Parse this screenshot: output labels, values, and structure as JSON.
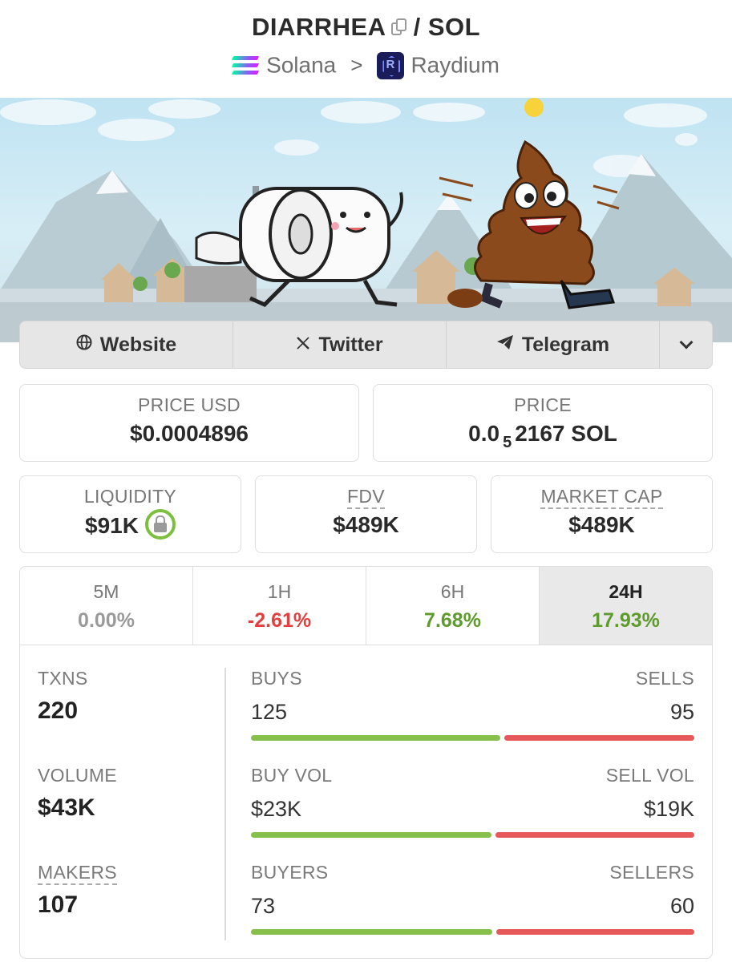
{
  "header": {
    "token": "DIARRHEA",
    "separator": "/",
    "quote": "SOL",
    "chain": "Solana",
    "dex": "Raydium"
  },
  "icons": {
    "copy": "copy-icon",
    "chain": "solana-logo-icon",
    "dex": "raydium-logo-icon",
    "website": "globe-icon",
    "twitter": "x-logo-icon",
    "telegram": "telegram-plane-icon",
    "more": "chevron-down-icon",
    "lock": "lock-icon"
  },
  "socials": {
    "website": "Website",
    "twitter": "Twitter",
    "telegram": "Telegram"
  },
  "price": {
    "usd_label": "PRICE USD",
    "usd_value": "$0.0004896",
    "native_label": "PRICE",
    "native_prefix": "0.0",
    "native_zeros": "5",
    "native_rest": "2167 SOL"
  },
  "metrics": {
    "liquidity_label": "LIQUIDITY",
    "liquidity_value": "$91K",
    "fdv_label": "FDV",
    "fdv_value": "$489K",
    "mcap_label": "MARKET CAP",
    "mcap_value": "$489K"
  },
  "timeframes": [
    {
      "label": "5M",
      "change": "0.00%"
    },
    {
      "label": "1H",
      "change": "-2.61%"
    },
    {
      "label": "6H",
      "change": "7.68%"
    },
    {
      "label": "24H",
      "change": "17.93%"
    }
  ],
  "selected_timeframe": "24H",
  "stats": {
    "txns_label": "TXNS",
    "txns_value": "220",
    "volume_label": "VOLUME",
    "volume_value": "$43K",
    "makers_label": "MAKERS",
    "makers_value": "107",
    "buys_label": "BUYS",
    "buys_value": "125",
    "sells_label": "SELLS",
    "sells_value": "95",
    "buy_vol_label": "BUY VOL",
    "buy_vol_value": "$23K",
    "sell_vol_label": "SELL VOL",
    "sell_vol_value": "$19K",
    "buyers_label": "BUYERS",
    "buyers_value": "73",
    "sellers_label": "SELLERS",
    "sellers_value": "60"
  },
  "bars": {
    "txns_buy_fraction": 0.568,
    "volume_buy_fraction": 0.548,
    "makers_buy_fraction": 0.549
  },
  "colors": {
    "positive": "#5e9b2c",
    "negative": "#e0403e",
    "buy_bar": "#86c04a",
    "sell_bar": "#e6585a",
    "lock_ring": "#7cbf3f"
  }
}
